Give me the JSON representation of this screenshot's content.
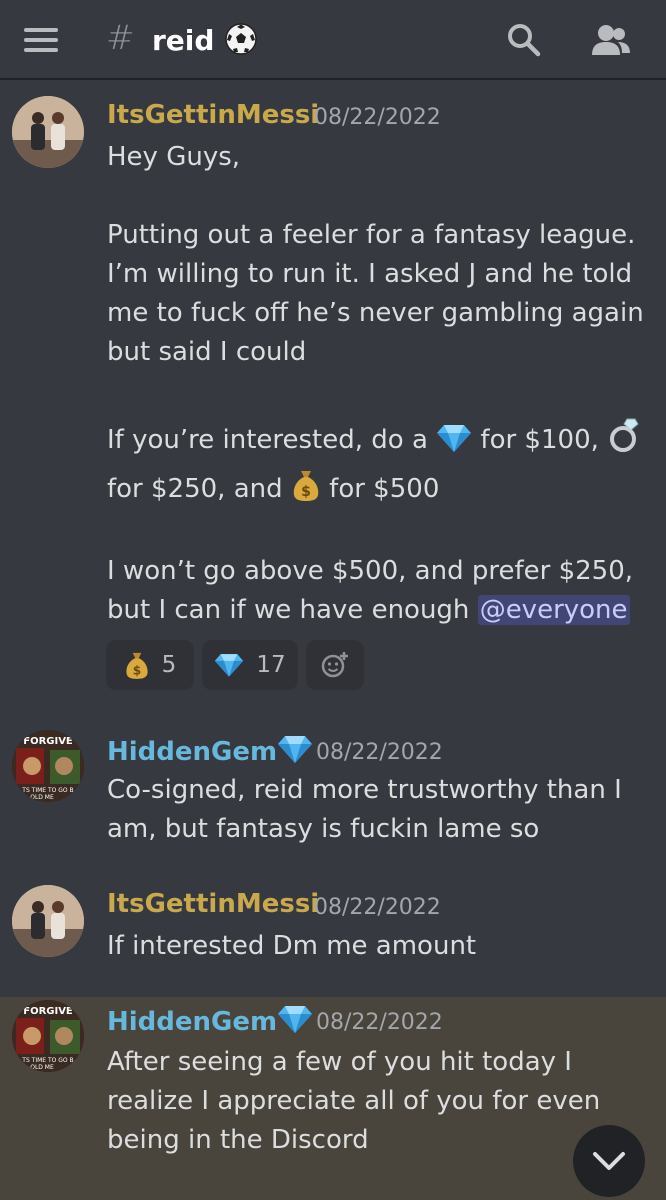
{
  "header": {
    "hash": "#",
    "channel_name": "reid"
  },
  "messages": [
    {
      "author": "ItsGettinMessi",
      "timestamp": "08/22/2022",
      "lines": {
        "l1": "Hey Guys,",
        "l2": "Putting out a feeler for a fantasy league.",
        "l3": "I’m willing to run it. I asked J and he told",
        "l4": "me to fuck off he’s never gambling again",
        "l5": "but said I could",
        "l6a": "If you’re interested, do a",
        "l6b": "for $100,",
        "l7a": "for $250, and",
        "l7b": "for $500",
        "l8": "I won’t go above $500, and prefer $250,",
        "l9a": "but I can if we have enough",
        "mention": "@everyone"
      },
      "reactions": [
        {
          "emoji": "money-bag",
          "count": "5"
        },
        {
          "emoji": "gem",
          "count": "17"
        }
      ]
    },
    {
      "author": "HiddenGem",
      "timestamp": "08/22/2022",
      "lines": {
        "l1": "Co-signed, reid more trustworthy than I",
        "l2": "am, but fantasy is fuckin lame so"
      }
    },
    {
      "author": "ItsGettinMessi",
      "timestamp": "08/22/2022",
      "lines": {
        "l1": "If interested Dm me amount"
      }
    },
    {
      "author": "HiddenGem",
      "timestamp": "08/22/2022",
      "lines": {
        "l1": "After seeing a few of you hit today I",
        "l2": "realize I appreciate all of you for even",
        "l3": "being in the Discord"
      }
    }
  ],
  "avatar_text": {
    "top": "FORGIVE",
    "bottom": "TS TIME TO GO B",
    "bottom2": "OLD ME"
  },
  "colors": {
    "background": "#36393f",
    "gold_name": "#c9a94b",
    "blue_name": "#67b8dc",
    "highlight": "#49443c",
    "mention_bg": "#414675"
  }
}
